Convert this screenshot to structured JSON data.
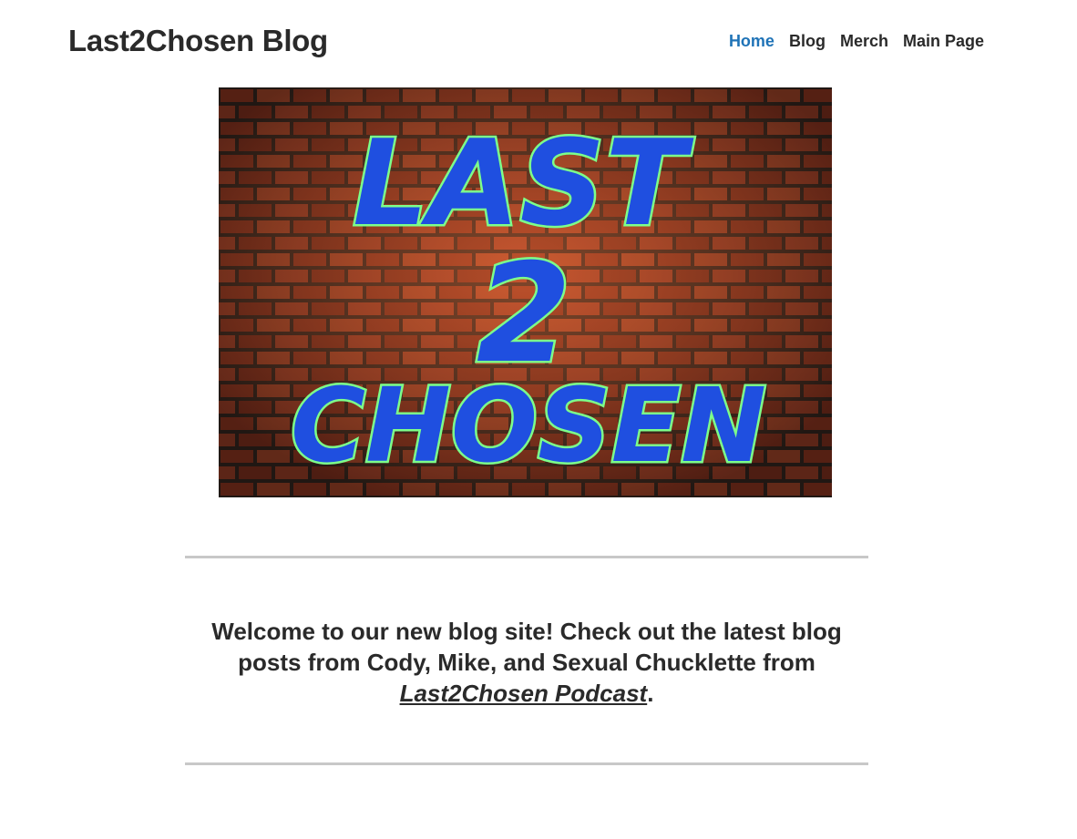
{
  "site": {
    "title": "Last2Chosen Blog"
  },
  "nav": {
    "items": [
      {
        "label": "Home",
        "active": true
      },
      {
        "label": "Blog",
        "active": false
      },
      {
        "label": "Merch",
        "active": false
      },
      {
        "label": "Main Page",
        "active": false
      }
    ]
  },
  "hero": {
    "logo_lines": [
      "LAST",
      "2",
      "CHOSEN"
    ],
    "colors": {
      "letter_fill": "#1f4fe0",
      "letter_outline": "#7dff8a",
      "brick": "#9a3a23",
      "mortar": "#3a2a22"
    }
  },
  "welcome": {
    "text": "Welcome to our new blog site! Check out the latest blog posts from Cody, Mike, and Sexual Chucklette from",
    "link": "Last2Chosen Podcast",
    "suffix": "."
  },
  "colors": {
    "nav_active": "#1f73b7",
    "text": "#2a2a2a",
    "divider": "#c8c8c8"
  }
}
